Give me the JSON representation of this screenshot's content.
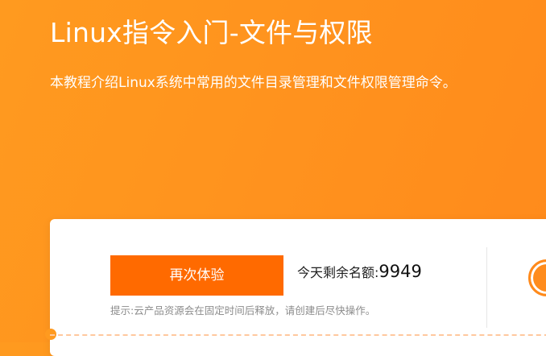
{
  "hero": {
    "title": "Linux指令入门-文件与权限",
    "description": "本教程介绍Linux系统中常用的文件目录管理和文件权限管理命令。"
  },
  "card": {
    "retry_label": "再次体验",
    "quota_label": "今天剩余名额:",
    "quota_value": "9949",
    "hint": "提示:云产品资源会在固定时间后释放，请创建后尽快操作。"
  },
  "colors": {
    "background": "#ff931e",
    "accent": "#ff6a00",
    "card": "#ffffff",
    "hint_text": "#8c8c8c"
  }
}
